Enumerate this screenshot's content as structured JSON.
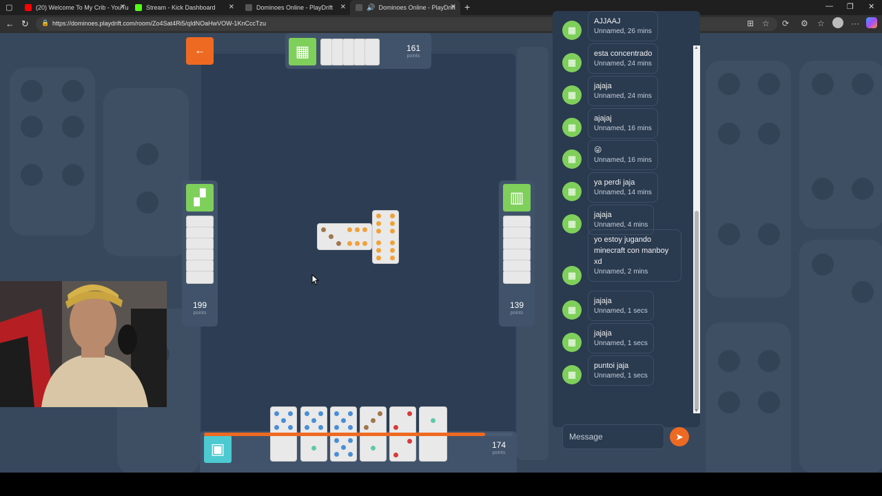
{
  "browser": {
    "tabs": [
      {
        "label": "(20) Welcome To My Crib - YouTu",
        "icon": "youtube-icon",
        "color": "#ff0000"
      },
      {
        "label": "Stream - Kick Dashboard",
        "icon": "kick-icon",
        "color": "#53fc18"
      },
      {
        "label": "Dominoes Online - PlayDrift",
        "icon": "playdrift-icon",
        "color": "#666666"
      },
      {
        "label": "Dominoes Online - PlayDrift",
        "icon": "playdrift-icon",
        "color": "#666666"
      }
    ],
    "url": "https://dominoes.playdrift.com/room/Zo4Sat4Ri5/qIdNOaHwVOW-1KnCccTzu"
  },
  "game": {
    "top_player": {
      "points": "161",
      "points_label": "points",
      "tiles": 5
    },
    "left_player": {
      "points": "199",
      "points_label": "points",
      "tiles": 6
    },
    "right_player": {
      "points": "139",
      "points_label": "points",
      "tiles": 6
    },
    "me": {
      "points": "174",
      "points_label": "points"
    },
    "turn_progress": 0.91,
    "colors": {
      "orange": "#ee6a22",
      "green": "#7fcf5b",
      "cyan": "#4cc9d1"
    }
  },
  "chat": {
    "messages": [
      {
        "text": "AJJAAJ",
        "meta": "Unnamed, 26 mins"
      },
      {
        "text": "esta concentrado",
        "meta": "Unnamed, 24 mins"
      },
      {
        "text": "jajaja",
        "meta": "Unnamed, 24 mins"
      },
      {
        "text": "ajajaj",
        "meta": "Unnamed, 16 mins"
      },
      {
        "text": "😜",
        "meta": "Unnamed, 16 mins"
      },
      {
        "text": "ya perdi jaja",
        "meta": "Unnamed, 14 mins"
      },
      {
        "text": "jajaja",
        "meta": "Unnamed, 4 mins"
      },
      {
        "text": "yo estoy jugando minecraft con manboy xd",
        "meta": "Unnamed, 2 mins"
      },
      {
        "text": "jajaja",
        "meta": "Unnamed, 1 secs"
      },
      {
        "text": "jajaja",
        "meta": "Unnamed, 1 secs"
      },
      {
        "text": "puntoi jaja",
        "meta": "Unnamed, 1 secs"
      }
    ],
    "placeholder": "Message"
  }
}
